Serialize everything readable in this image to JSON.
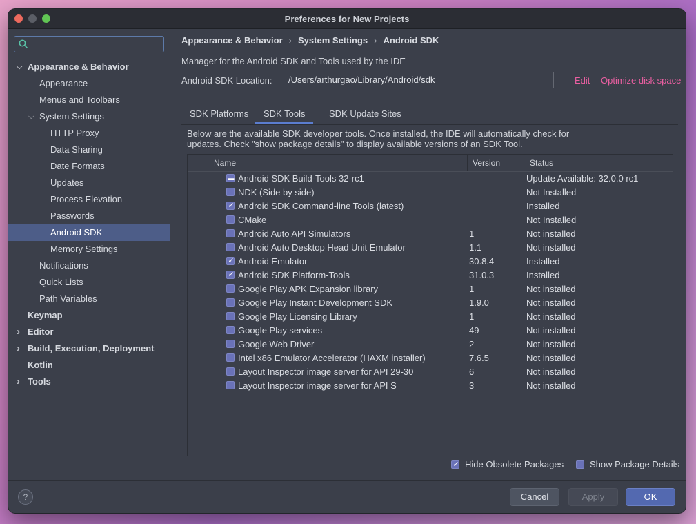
{
  "window": {
    "title": "Preferences for New Projects"
  },
  "search": {
    "placeholder": ""
  },
  "sidebar": {
    "items": [
      {
        "label": "Appearance & Behavior",
        "level": 0,
        "bold": true,
        "chevron": "open"
      },
      {
        "label": "Appearance",
        "level": 1
      },
      {
        "label": "Menus and Toolbars",
        "level": 1
      },
      {
        "label": "System Settings",
        "level": 1,
        "chevron": "open"
      },
      {
        "label": "HTTP Proxy",
        "level": 2
      },
      {
        "label": "Data Sharing",
        "level": 2
      },
      {
        "label": "Date Formats",
        "level": 2
      },
      {
        "label": "Updates",
        "level": 2
      },
      {
        "label": "Process Elevation",
        "level": 2
      },
      {
        "label": "Passwords",
        "level": 2
      },
      {
        "label": "Android SDK",
        "level": 2,
        "selected": true
      },
      {
        "label": "Memory Settings",
        "level": 2
      },
      {
        "label": "Notifications",
        "level": 1
      },
      {
        "label": "Quick Lists",
        "level": 1
      },
      {
        "label": "Path Variables",
        "level": 1
      },
      {
        "label": "Keymap",
        "level": 0,
        "bold": true
      },
      {
        "label": "Editor",
        "level": 0,
        "bold": true,
        "chevron": "closed"
      },
      {
        "label": "Build, Execution, Deployment",
        "level": 0,
        "bold": true,
        "chevron": "closed"
      },
      {
        "label": "Kotlin",
        "level": 0,
        "bold": true
      },
      {
        "label": "Tools",
        "level": 0,
        "bold": true,
        "chevron": "closed"
      }
    ]
  },
  "breadcrumb": {
    "part1": "Appearance & Behavior",
    "part2": "System Settings",
    "part3": "Android SDK",
    "separator": "›"
  },
  "main": {
    "description": "Manager for the Android SDK and Tools used by the IDE",
    "location_label": "Android SDK Location:",
    "location_value": "/Users/arthurgao/Library/Android/sdk",
    "edit_link": "Edit",
    "optimize_link": "Optimize disk space",
    "tabs": [
      {
        "label": "SDK Platforms"
      },
      {
        "label": "SDK Tools",
        "active": true
      },
      {
        "label": "SDK Update Sites"
      }
    ],
    "note_line1": "Below are the available SDK developer tools. Once installed, the IDE will automatically check for",
    "note_line2": "updates. Check \"show package details\" to display available versions of an SDK Tool."
  },
  "table": {
    "headers": {
      "name": "Name",
      "version": "Version",
      "status": "Status"
    },
    "rows": [
      {
        "name": "Android SDK Build-Tools 32-rc1",
        "version": "",
        "status": "Update Available: 32.0.0 rc1",
        "state": "partial"
      },
      {
        "name": "NDK (Side by side)",
        "version": "",
        "status": "Not Installed",
        "state": "unchecked"
      },
      {
        "name": "Android SDK Command-line Tools (latest)",
        "version": "",
        "status": "Installed",
        "state": "checked"
      },
      {
        "name": "CMake",
        "version": "",
        "status": "Not Installed",
        "state": "unchecked"
      },
      {
        "name": "Android Auto API Simulators",
        "version": "1",
        "status": "Not installed",
        "state": "unchecked"
      },
      {
        "name": "Android Auto Desktop Head Unit Emulator",
        "version": "1.1",
        "status": "Not installed",
        "state": "unchecked"
      },
      {
        "name": "Android Emulator",
        "version": "30.8.4",
        "status": "Installed",
        "state": "checked"
      },
      {
        "name": "Android SDK Platform-Tools",
        "version": "31.0.3",
        "status": "Installed",
        "state": "checked"
      },
      {
        "name": "Google Play APK Expansion library",
        "version": "1",
        "status": "Not installed",
        "state": "unchecked"
      },
      {
        "name": "Google Play Instant Development SDK",
        "version": "1.9.0",
        "status": "Not installed",
        "state": "unchecked"
      },
      {
        "name": "Google Play Licensing Library",
        "version": "1",
        "status": "Not installed",
        "state": "unchecked"
      },
      {
        "name": "Google Play services",
        "version": "49",
        "status": "Not installed",
        "state": "unchecked"
      },
      {
        "name": "Google Web Driver",
        "version": "2",
        "status": "Not installed",
        "state": "unchecked"
      },
      {
        "name": "Intel x86 Emulator Accelerator (HAXM installer)",
        "version": "7.6.5",
        "status": "Not installed",
        "state": "unchecked"
      },
      {
        "name": "Layout Inspector image server for API 29-30",
        "version": "6",
        "status": "Not installed",
        "state": "unchecked"
      },
      {
        "name": "Layout Inspector image server for API S",
        "version": "3",
        "status": "Not installed",
        "state": "unchecked"
      }
    ]
  },
  "options": {
    "hide_obsolete": {
      "label": "Hide Obsolete Packages",
      "checked": true
    },
    "show_details": {
      "label": "Show Package Details",
      "checked": false
    }
  },
  "footer": {
    "help": "?",
    "cancel": "Cancel",
    "apply": "Apply",
    "ok": "OK"
  },
  "colors": {
    "link": "#e95fa1",
    "selection": "#4d5d88",
    "accent": "#5b7dcf",
    "checkbox": "#6a72b8"
  }
}
